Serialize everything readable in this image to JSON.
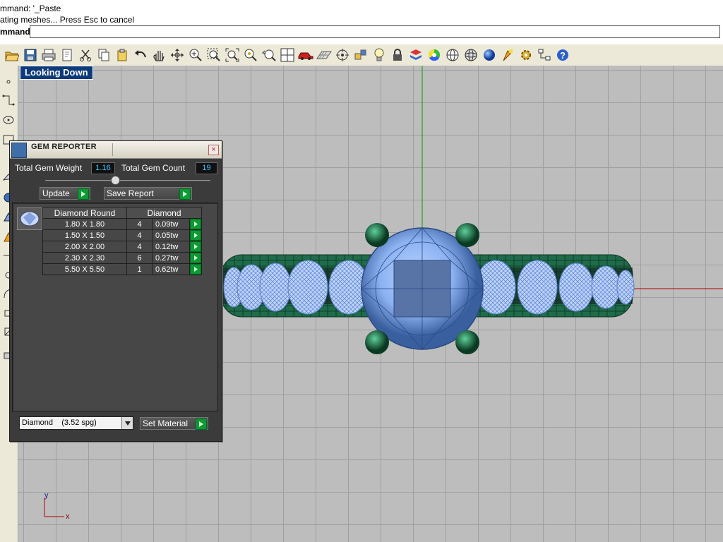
{
  "command_history": {
    "line1": "mmand: '_Paste",
    "line2": "ating meshes... Press Esc to cancel",
    "prompt": "mmand:"
  },
  "toolbar": {
    "icons": [
      "open-icon",
      "save-icon",
      "print-icon",
      "import-icon",
      "cut-icon",
      "copy-icon",
      "paste-icon",
      "undo-icon",
      "pan-hand-icon",
      "rotate-icon",
      "zoom-dynamic-icon",
      "zoom-window-icon",
      "zoom-extents-icon",
      "zoom-selected-icon",
      "undo-view-icon",
      "four-viewports-icon",
      "car-icon",
      "grid-plane-icon",
      "target-icon",
      "snap-icon",
      "light-bulb-icon",
      "lock-icon",
      "layer-icon",
      "color-wheel-icon",
      "wireframe-sphere-icon",
      "render-sphere-icon",
      "blue-sphere-icon",
      "paint-pointer-icon",
      "gear-icon",
      "hierarchy-icon",
      "help-icon"
    ]
  },
  "viewport": {
    "label": "Looking Down",
    "axis_x_label": "x",
    "axis_y_label": "y",
    "colors": {
      "grid": "#9f9f9f",
      "background": "#bdbdbd",
      "axis_x": "#b00000",
      "axis_y": "#00a000",
      "metal": "#1f6b4a",
      "gem": "#9ec4ff"
    }
  },
  "gem_reporter": {
    "title": "GEM REPORTER",
    "total_weight_label": "Total Gem Weight",
    "total_weight_value": "1.16",
    "total_count_label": "Total Gem Count",
    "total_count_value": "19",
    "update_label": "Update",
    "save_report_label": "Save Report",
    "table_headers": [
      "Diamond Round",
      "Diamond"
    ],
    "rows": [
      {
        "size": "1.80 X 1.80",
        "qty": "4",
        "weight": "0.09tw"
      },
      {
        "size": "1.50 X 1.50",
        "qty": "4",
        "weight": "0.05tw"
      },
      {
        "size": "2.00 X 2.00",
        "qty": "4",
        "weight": "0.12tw"
      },
      {
        "size": "2.30 X 2.30",
        "qty": "6",
        "weight": "0.27tw"
      },
      {
        "size": "5.50 X 5.50",
        "qty": "1",
        "weight": "0.62tw"
      }
    ],
    "material_selected": "Diamond    (3.52 spg)",
    "set_material_label": "Set Material"
  }
}
